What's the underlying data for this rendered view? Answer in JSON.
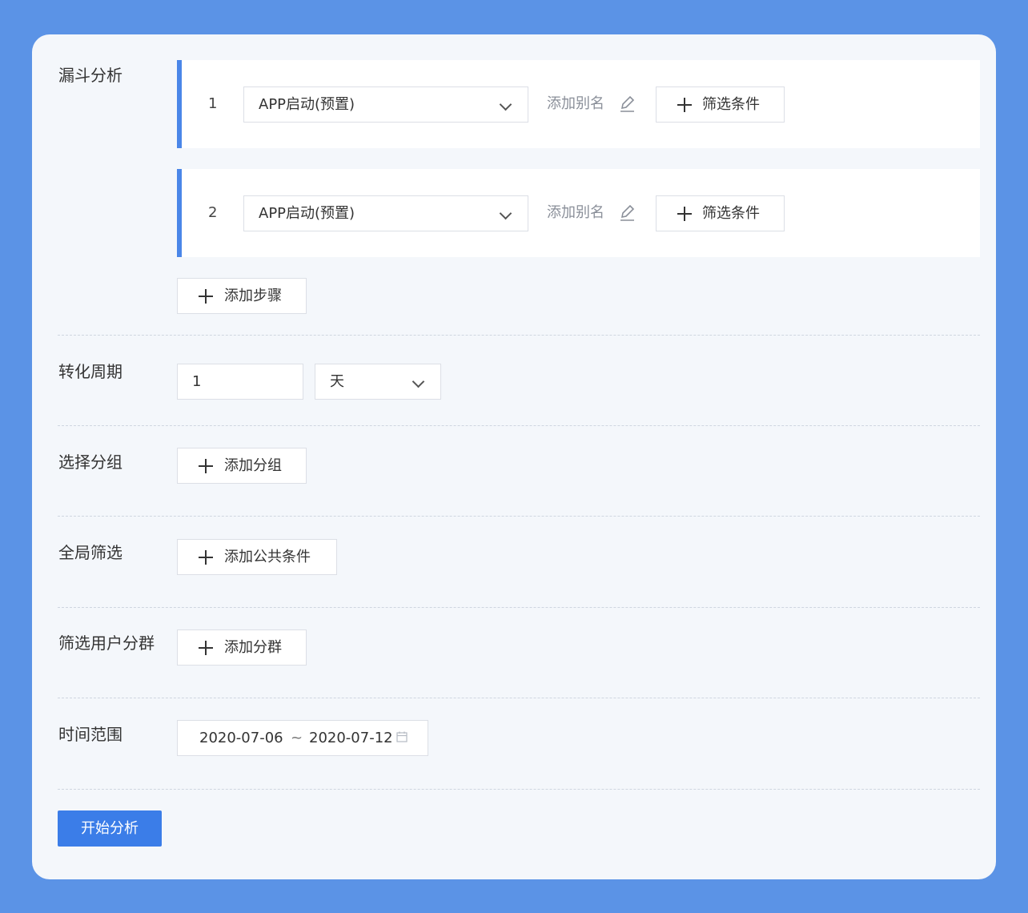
{
  "funnel": {
    "label": "漏斗分析",
    "steps": [
      {
        "number": "1",
        "event": "APP启动(预置)",
        "alias": "添加别名",
        "filter": "筛选条件"
      },
      {
        "number": "2",
        "event": "APP启动(预置)",
        "alias": "添加别名",
        "filter": "筛选条件"
      }
    ],
    "add_step": "添加步骤"
  },
  "conversion": {
    "label": "转化周期",
    "value": "1",
    "unit": "天"
  },
  "group": {
    "label": "选择分组",
    "add": "添加分组"
  },
  "global_filter": {
    "label": "全局筛选",
    "add": "添加公共条件"
  },
  "segment": {
    "label": "筛选用户分群",
    "add": "添加分群"
  },
  "time_range": {
    "label": "时间范围",
    "start": "2020-07-06",
    "separator": "~",
    "end": "2020-07-12"
  },
  "actions": {
    "start": "开始分析"
  },
  "colors": {
    "background": "#5b93e6",
    "accent": "#3b7de8"
  }
}
